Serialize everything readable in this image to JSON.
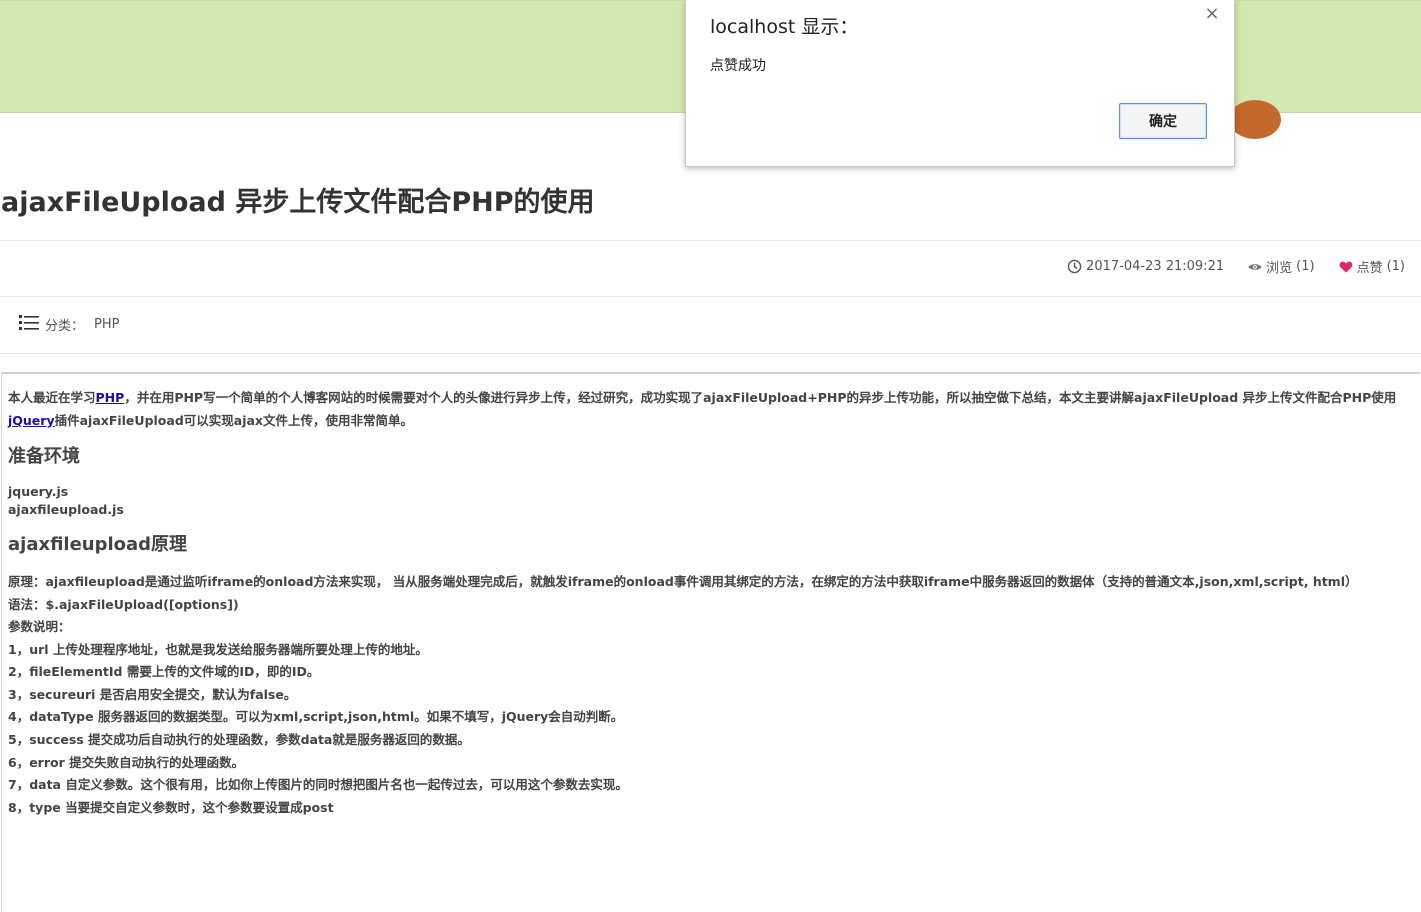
{
  "article": {
    "title": "ajaxFileUpload 异步上传文件配合PHP的使用",
    "date": "2017-04-23 21:09:21",
    "views_label": "浏览",
    "views": "(1)",
    "likes_label": "点赞",
    "likes": "(1)",
    "category_label": "分类：",
    "category": "PHP"
  },
  "content": {
    "intro_pre": "本人最近在学习",
    "intro_link": "PHP",
    "intro_post": "，并在用PHP写一个简单的个人博客网站的时候需要对个人的头像进行异步上传，经过研究，成功实现了ajaxFileUpload+PHP的异步上传功能，所以抽空做下总结，本文主要讲解ajaxFileUpload 异步上传文件配合PHP使用",
    "line2_link": "jQuery",
    "line2_post": "插件ajaxFileUpload可以实现ajax文件上传，使用非常简单。",
    "h_env": "准备环境",
    "env_lines": [
      "jquery.js",
      "ajaxfileupload.js"
    ],
    "h_principle": "ajaxfileupload原理",
    "principle": "原理：ajaxfileupload是通过监听iframe的onload方法来实现， 当从服务端处理完成后，就触发iframe的onload事件调用其绑定的方法，在绑定的方法中获取iframe中服务器返回的数据体（支持的普通文本,json,xml,script, html）",
    "syntax": "语法：$.ajaxFileUpload([options])",
    "params_title": "参数说明：",
    "params": [
      "1，url 上传处理程序地址，也就是我发送给服务器端所要处理上传的地址。",
      "2，fileElementId 需要上传的文件域的ID，即的ID。",
      "3，secureuri 是否启用安全提交，默认为false。",
      "4，dataType 服务器返回的数据类型。可以为xml,script,json,html。如果不填写，jQuery会自动判断。",
      "5，success 提交成功后自动执行的处理函数，参数data就是服务器返回的数据。",
      "6，error 提交失败自动执行的处理函数。",
      "7，data 自定义参数。这个很有用，比如你上传图片的同时想把图片名也一起传过去，可以用这个参数去实现。",
      "8，type 当要提交自定义参数时，这个参数要设置成post"
    ]
  },
  "dialog": {
    "title": "localhost 显示：",
    "close": "×",
    "message": "点赞成功",
    "ok_label": "确定"
  },
  "icons": {
    "clock": "clock-icon",
    "eye": "eye-icon",
    "heart": "heart-icon",
    "list": "list-icon"
  },
  "colors": {
    "header_band": "#d3e8b0",
    "heart": "#e0256f",
    "link": "#1a0dab",
    "button_border": "#4d90fe"
  }
}
